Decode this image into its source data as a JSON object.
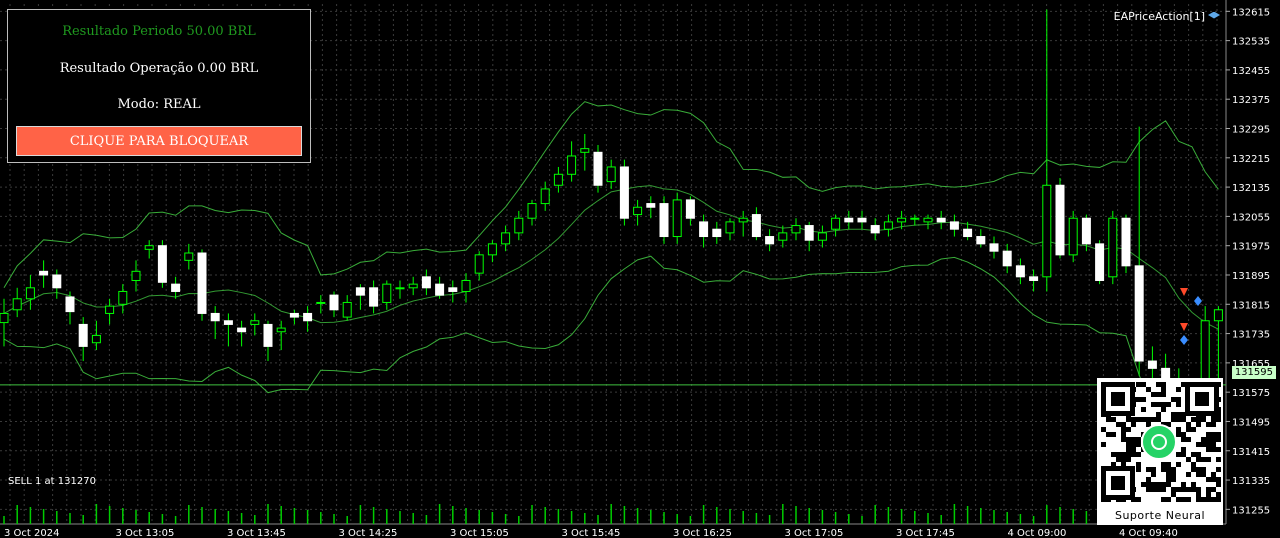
{
  "panel": {
    "period_result": "Resultado Periodo 50.00 BRL",
    "operation_result": "Resultado Operação 0.00 BRL",
    "mode": "Modo: REAL",
    "lock_button": "CLIQUE PARA BLOQUEAR"
  },
  "indicator_label": "EAPriceAction[1]",
  "current_price": "131595",
  "sell_note": "SELL 1 at 131270",
  "qr": {
    "title": "Suporte Neural",
    "icon": "whatsapp-icon"
  },
  "colors": {
    "bull_candle": "#ffffff",
    "bear_candle": "#ffffff",
    "wick": "#00ff00",
    "bands": "#3fbf3f",
    "grid": "#3a3a3a",
    "button": "#ff6347"
  },
  "chart_data": {
    "type": "candlestick",
    "y_ticks": [
      "132615",
      "132535",
      "132455",
      "132375",
      "132295",
      "132215",
      "132135",
      "132055",
      "131975",
      "131895",
      "131815",
      "131735",
      "131655",
      "131575",
      "131495",
      "131415",
      "131335",
      "131255"
    ],
    "x_ticks": [
      "3 Oct 2024",
      "3 Oct 13:05",
      "3 Oct 13:45",
      "3 Oct 14:25",
      "3 Oct 15:05",
      "3 Oct 15:45",
      "3 Oct 16:25",
      "3 Oct 17:05",
      "3 Oct 17:45",
      "4 Oct 09:00",
      "4 Oct 09:40"
    ],
    "ylim": [
      131215,
      132635
    ],
    "current_price": 131595,
    "candles": [
      [
        131765,
        131790,
        131700,
        131830
      ],
      [
        131800,
        131830,
        131780,
        131860
      ],
      [
        131830,
        131860,
        131800,
        131895
      ],
      [
        131905,
        131895,
        131860,
        131935
      ],
      [
        131895,
        131860,
        131830,
        131910
      ],
      [
        131835,
        131795,
        131760,
        131850
      ],
      [
        131760,
        131700,
        131660,
        131780
      ],
      [
        131710,
        131730,
        131690,
        131770
      ],
      [
        131790,
        131810,
        131760,
        131830
      ],
      [
        131815,
        131850,
        131790,
        131870
      ],
      [
        131880,
        131905,
        131850,
        131935
      ],
      [
        131965,
        131975,
        131940,
        131990
      ],
      [
        131975,
        131875,
        131860,
        131990
      ],
      [
        131870,
        131850,
        131830,
        131890
      ],
      [
        131935,
        131955,
        131910,
        131980
      ],
      [
        131955,
        131790,
        131770,
        131965
      ],
      [
        131790,
        131770,
        131720,
        131810
      ],
      [
        131770,
        131760,
        131700,
        131790
      ],
      [
        131750,
        131740,
        131700,
        131770
      ],
      [
        131760,
        131770,
        131730,
        131790
      ],
      [
        131760,
        131700,
        131660,
        131770
      ],
      [
        131740,
        131750,
        131690,
        131770
      ],
      [
        131790,
        131780,
        131760,
        131800
      ],
      [
        131790,
        131770,
        131740,
        131810
      ],
      [
        131820,
        131820,
        131790,
        131840
      ],
      [
        131840,
        131800,
        131780,
        131850
      ],
      [
        131780,
        131820,
        131770,
        131840
      ],
      [
        131860,
        131840,
        131800,
        131870
      ],
      [
        131860,
        131810,
        131790,
        131880
      ],
      [
        131820,
        131870,
        131800,
        131880
      ],
      [
        131860,
        131860,
        131830,
        131880
      ],
      [
        131860,
        131870,
        131840,
        131890
      ],
      [
        131890,
        131860,
        131840,
        131910
      ],
      [
        131870,
        131840,
        131830,
        131890
      ],
      [
        131860,
        131850,
        131820,
        131880
      ],
      [
        131850,
        131880,
        131820,
        131900
      ],
      [
        131900,
        131950,
        131880,
        131960
      ],
      [
        131950,
        131980,
        131930,
        131990
      ],
      [
        131980,
        132010,
        131960,
        132030
      ],
      [
        132010,
        132050,
        131990,
        132070
      ],
      [
        132050,
        132090,
        132030,
        132100
      ],
      [
        132090,
        132130,
        132070,
        132150
      ],
      [
        132140,
        132170,
        132120,
        132190
      ],
      [
        132170,
        132220,
        132150,
        132260
      ],
      [
        132230,
        132240,
        132180,
        132280
      ],
      [
        132230,
        132140,
        132120,
        132250
      ],
      [
        132150,
        132190,
        132130,
        132210
      ],
      [
        132190,
        132050,
        132030,
        132210
      ],
      [
        132060,
        132080,
        132030,
        132100
      ],
      [
        132090,
        132080,
        132050,
        132110
      ],
      [
        132090,
        132000,
        131980,
        132110
      ],
      [
        132000,
        132100,
        131980,
        132120
      ],
      [
        132100,
        132050,
        132030,
        132110
      ],
      [
        132040,
        132000,
        131970,
        132060
      ],
      [
        132020,
        132000,
        131980,
        132040
      ],
      [
        132010,
        132040,
        131990,
        132050
      ],
      [
        132040,
        132050,
        132000,
        132070
      ],
      [
        132060,
        132000,
        131990,
        132080
      ],
      [
        132000,
        131980,
        131960,
        132020
      ],
      [
        131990,
        132010,
        131970,
        132030
      ],
      [
        132010,
        132030,
        131990,
        132050
      ],
      [
        132030,
        131990,
        131960,
        132040
      ],
      [
        131990,
        132010,
        131970,
        132030
      ],
      [
        132020,
        132050,
        132000,
        132060
      ],
      [
        132050,
        132040,
        132020,
        132070
      ],
      [
        132050,
        132040,
        132020,
        132070
      ],
      [
        132030,
        132010,
        131990,
        132050
      ],
      [
        132020,
        132040,
        132000,
        132060
      ],
      [
        132040,
        132050,
        132020,
        132070
      ],
      [
        132050,
        132050,
        132030,
        132060
      ],
      [
        132040,
        132050,
        132020,
        132060
      ],
      [
        132050,
        132040,
        132020,
        132070
      ],
      [
        132040,
        132020,
        132000,
        132060
      ],
      [
        132020,
        132000,
        131990,
        132040
      ],
      [
        132000,
        131980,
        131970,
        132020
      ],
      [
        131980,
        131960,
        131940,
        132000
      ],
      [
        131960,
        131920,
        131900,
        131980
      ],
      [
        131920,
        131890,
        131870,
        131940
      ],
      [
        131890,
        131880,
        131850,
        131910
      ],
      [
        131890,
        132140,
        131850,
        132620
      ],
      [
        132140,
        131950,
        131940,
        132160
      ],
      [
        131950,
        132050,
        131930,
        132070
      ],
      [
        132050,
        131980,
        131960,
        132060
      ],
      [
        131980,
        131880,
        131870,
        131990
      ],
      [
        131890,
        132050,
        131870,
        132070
      ],
      [
        132050,
        131920,
        131900,
        132060
      ],
      [
        131920,
        131660,
        131620,
        132300
      ],
      [
        131660,
        131640,
        131590,
        131700
      ],
      [
        131640,
        131610,
        131580,
        131680
      ],
      [
        131610,
        131580,
        131550,
        131640
      ],
      [
        131580,
        131560,
        131540,
        131600
      ],
      [
        131600,
        131770,
        131560,
        131810
      ],
      [
        131770,
        131800,
        131600,
        131810
      ]
    ]
  }
}
